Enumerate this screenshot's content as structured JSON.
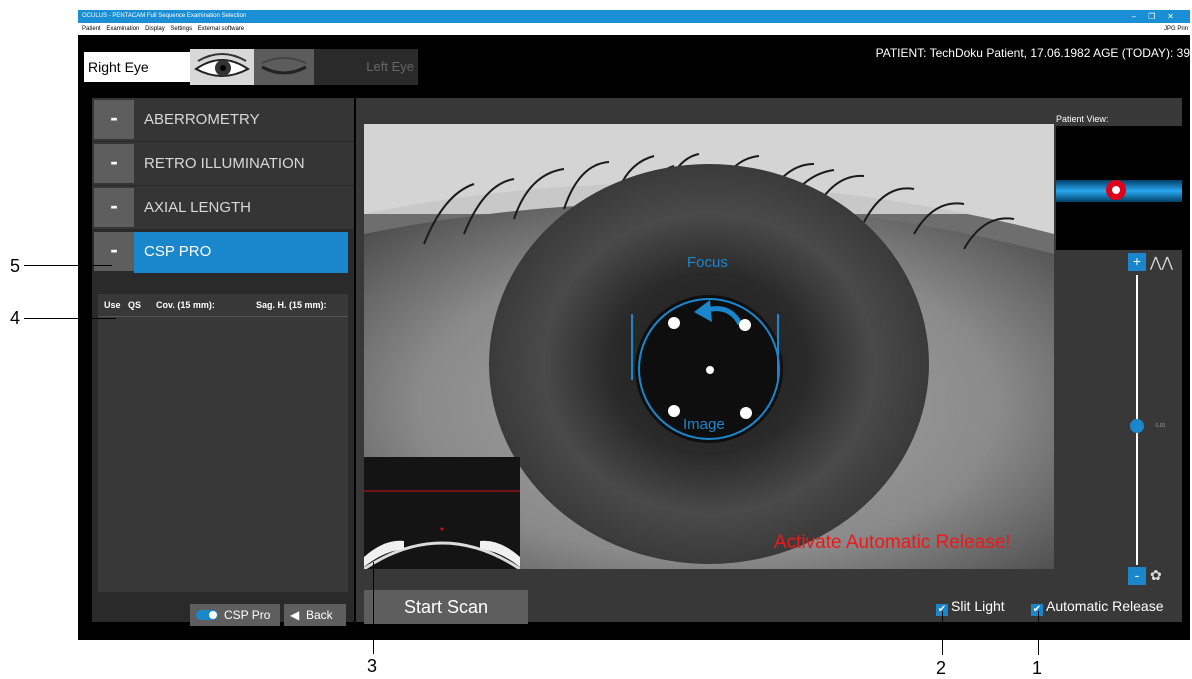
{
  "window": {
    "title": "OCULUS - PENTACAM Full Sequence Examination Selection",
    "controls": [
      "–",
      "❐",
      "✕"
    ]
  },
  "menu": {
    "items": [
      "Patient",
      "Examination",
      "Display",
      "Settings",
      "External software"
    ],
    "right": "JPG  Prin"
  },
  "eye_selector": {
    "right": "Right Eye",
    "left": "Left Eye"
  },
  "patient_info": "PATIENT: TechDoku Patient, 17.06.1982   AGE (TODAY): 39",
  "exams": [
    {
      "minus": "-",
      "label": "ABERROMETRY"
    },
    {
      "minus": "-",
      "label": "RETRO ILLUMINATION"
    },
    {
      "minus": "-",
      "label": "AXIAL LENGTH"
    },
    {
      "minus": "-",
      "label": "CSP PRO"
    }
  ],
  "list": {
    "headers": [
      "Use",
      "QS",
      "Cov. (15 mm):",
      "Sag. H. (15 mm):"
    ]
  },
  "buttons": {
    "csp_pro": "CSP Pro",
    "back_arrow": "◀",
    "back": "Back",
    "start_scan": "Start Scan"
  },
  "camera": {
    "focus_label": "Focus",
    "image_label": "Image",
    "warning": "Activate Automatic Release!"
  },
  "patient_view": {
    "label": "Patient View:"
  },
  "slider": {
    "plus": "+",
    "minus": "-",
    "value": "-1.01",
    "top_icon": "⋀⋀",
    "bottom_icon": "✿"
  },
  "checkboxes": {
    "check": "✔",
    "slit_light": "Slit Light",
    "automatic_release": "Automatic Release"
  },
  "annotations": [
    "5",
    "4",
    "3",
    "2",
    "1"
  ],
  "colors": {
    "accent": "#1a87cc",
    "warning": "#f01818",
    "fixation": "#e0001a"
  }
}
